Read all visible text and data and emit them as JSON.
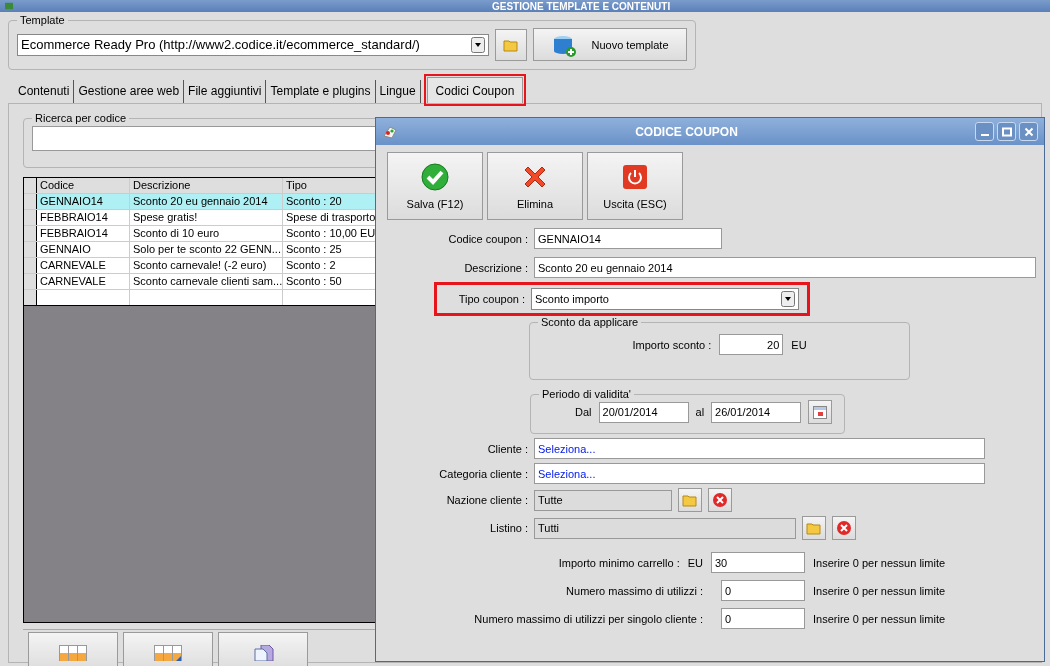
{
  "window": {
    "title": "GESTIONE TEMPLATE E CONTENUTI"
  },
  "template": {
    "label": "Template",
    "value": "Ecommerce Ready Pro (http://www2.codice.it/ecommerce_standard/)",
    "new_button": "Nuovo template"
  },
  "tabs": [
    {
      "label": "Contenuti",
      "selected": false,
      "highlighted": false
    },
    {
      "label": "Gestione aree web",
      "selected": false,
      "highlighted": false
    },
    {
      "label": "File aggiuntivi",
      "selected": false,
      "highlighted": false
    },
    {
      "label": "Template e plugins",
      "selected": false,
      "highlighted": false
    },
    {
      "label": "Lingue",
      "selected": false,
      "highlighted": false
    },
    {
      "label": "Codici Coupon",
      "selected": true,
      "highlighted": true
    }
  ],
  "search": {
    "label": "Ricerca per codice"
  },
  "table": {
    "columns": [
      "Codice",
      "Descrizione",
      "Tipo"
    ],
    "rows": [
      {
        "cells": [
          "GENNAIO14",
          "Sconto 20 eu gennaio 2014",
          "Sconto : 20"
        ],
        "selected": true
      },
      {
        "cells": [
          "FEBBRAIO14",
          "Spese gratis!",
          "Spese di trasporto"
        ],
        "selected": false
      },
      {
        "cells": [
          "FEBBRAIO14",
          "Sconto di 10 euro",
          "Sconto : 10,00 EU"
        ],
        "selected": false
      },
      {
        "cells": [
          "GENNAIO",
          "Solo per te sconto 22 GENN...",
          "Sconto : 25"
        ],
        "selected": false
      },
      {
        "cells": [
          "CARNEVALE",
          "Sconto carnevale! (-2 euro)",
          "Sconto : 2"
        ],
        "selected": false
      },
      {
        "cells": [
          "CARNEVALE",
          "Sconto carnevale clienti sam...",
          "Sconto : 50"
        ],
        "selected": false
      }
    ]
  },
  "dialog": {
    "title": "CODICE COUPON",
    "toolbar": [
      {
        "kind": "save",
        "label": "Salva (F12)"
      },
      {
        "kind": "delete",
        "label": "Elimina"
      },
      {
        "kind": "exit",
        "label": "Uscita (ESC)"
      }
    ],
    "code": {
      "label": "Codice coupon :",
      "value": "GENNAIO14"
    },
    "description": {
      "label": "Descrizione :",
      "value": "Sconto 20 eu gennaio 2014"
    },
    "type": {
      "label": "Tipo coupon :",
      "value": "Sconto importo",
      "highlighted": true
    },
    "discount": {
      "title": "Sconto da applicare",
      "label": "Importo sconto :",
      "value": "20",
      "unit": "EU"
    },
    "validity": {
      "title": "Periodo di validita'",
      "from_label": "Dal",
      "from": "20/01/2014",
      "to_label": "al",
      "to": "26/01/2014"
    },
    "customer": {
      "label": "Cliente :",
      "value": "Seleziona..."
    },
    "customer_category": {
      "label": "Categoria cliente :",
      "value": "Seleziona..."
    },
    "country": {
      "label": "Nazione cliente :",
      "value": "Tutte"
    },
    "price_list": {
      "label": "Listino :",
      "value": "Tutti"
    },
    "limits": [
      {
        "label": "Importo minimo carrello :",
        "unit": "EU",
        "value": "30",
        "hint": "Inserire 0 per nessun limite"
      },
      {
        "label": "Numero massimo di utilizzi :",
        "value": "0",
        "hint": "Inserire 0 per nessun limite"
      },
      {
        "label": "Numero massimo di utilizzi per singolo cliente :",
        "value": "0",
        "hint": "Inserire 0 per nessun limite"
      }
    ]
  }
}
